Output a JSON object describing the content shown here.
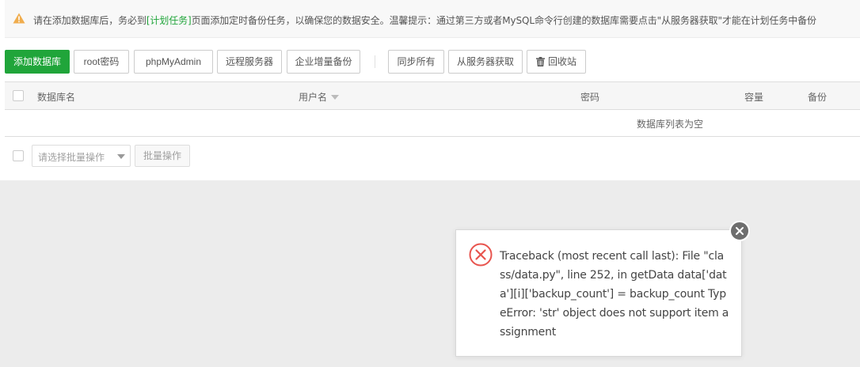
{
  "alert": {
    "text_before": "请在添加数据库后，务必到",
    "link": "[计划任务]",
    "text_after": "页面添加定时备份任务，以确保您的数据安全。温馨提示：通过第三方或者MySQL命令行创建的数据库需要点击\"从服务器获取\"才能在计划任务中备份",
    "icon": "warning-icon",
    "icon_color": "#f0ad4e"
  },
  "toolbar": {
    "add_db": "添加数据库",
    "root_password": "root密码",
    "phpmyadmin": "phpMyAdmin",
    "remote_server": "远程服务器",
    "incremental_backup": "企业增量备份",
    "sync_all": "同步所有",
    "fetch_from_server": "从服务器获取",
    "recycle_bin": "回收站"
  },
  "table": {
    "columns": [
      "数据库名",
      "用户名",
      "密码",
      "容量",
      "备份"
    ],
    "empty_text": "数据库列表为空"
  },
  "batch": {
    "select_placeholder": "请选择批量操作",
    "button": "批量操作"
  },
  "error_dialog": {
    "message": "Traceback (most recent call last): File \"class/data.py\", line 252, in getData data['data'][i]['backup_count'] = backup_count TypeError: 'str' object does not support item assignment",
    "icon": "error-circle-icon",
    "icon_color": "#e8544e"
  },
  "colors": {
    "primary": "#20a53a",
    "close_button": "#6e6e6e"
  }
}
